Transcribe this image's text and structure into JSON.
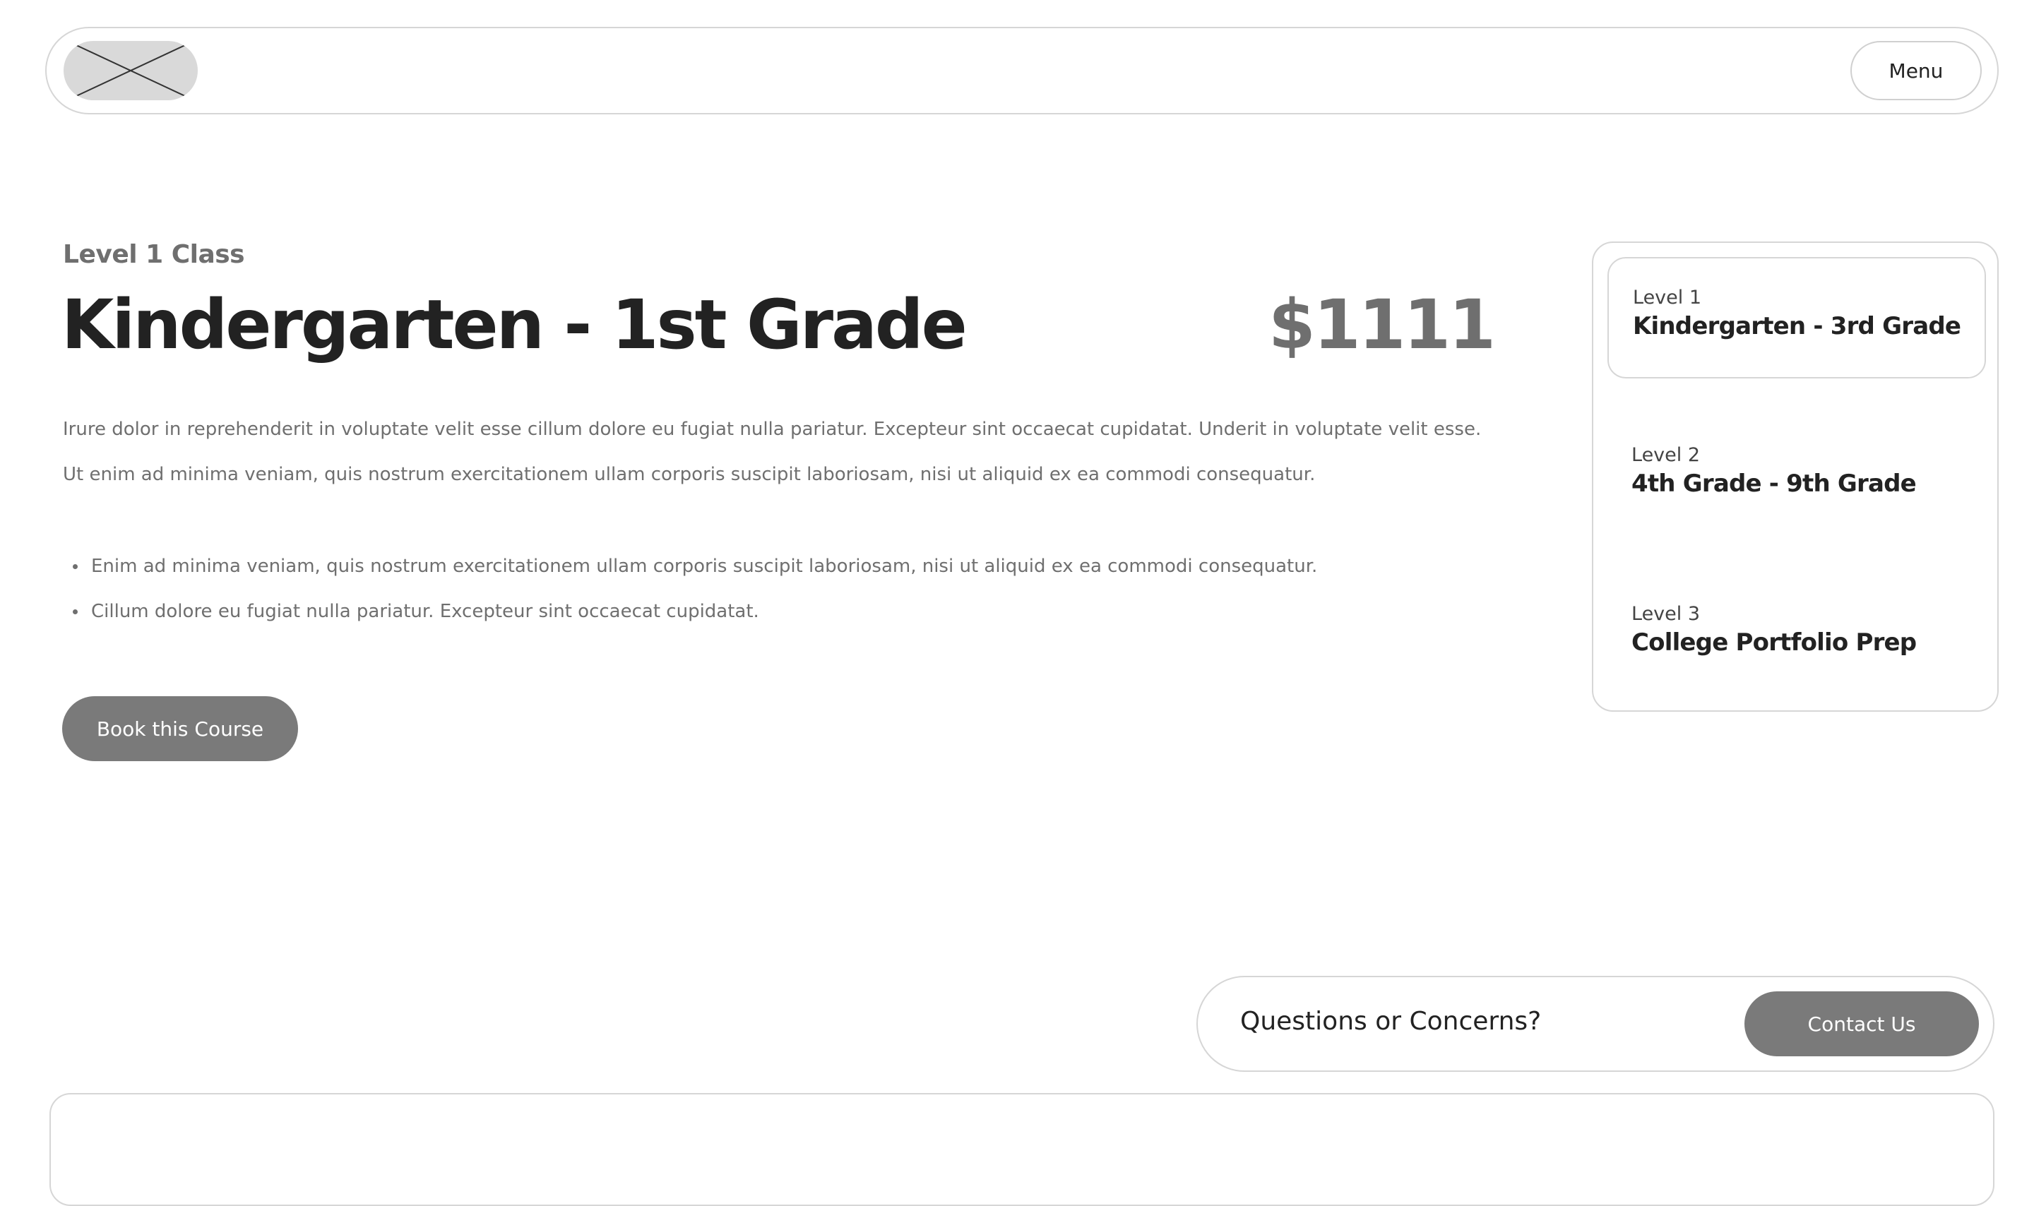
{
  "header": {
    "logo_icon": "placeholder-image-icon",
    "menu_label": "Menu"
  },
  "course": {
    "eyebrow": "Level 1 Class",
    "title": "Kindergarten - 1st Grade",
    "price": "$1111",
    "description": "Irure dolor in reprehenderit in voluptate velit esse cillum dolore eu fugiat nulla pariatur. Excepteur sint occaecat cupidatat. Underit in voluptate velit esse. Ut enim ad minima veniam, quis nostrum exercitationem ullam corporis suscipit laboriosam, nisi ut aliquid ex ea commodi consequatur.",
    "bullets": [
      "Enim ad minima veniam, quis nostrum exercitationem ullam corporis suscipit laboriosam, nisi ut aliquid ex ea commodi consequatur.",
      "Cillum dolore eu fugiat nulla pariatur. Excepteur sint occaecat cupidatat."
    ],
    "book_label": "Book this Course"
  },
  "levels": [
    {
      "level": "Level 1",
      "grade": "Kindergarten - 3rd Grade",
      "active": true
    },
    {
      "level": "Level 2",
      "grade": "4th Grade - 9th Grade",
      "active": false
    },
    {
      "level": "Level 3",
      "grade": "College Portfolio Prep",
      "active": false
    }
  ],
  "contact": {
    "prompt": "Questions or Concerns?",
    "button_label": "Contact Us"
  },
  "colors": {
    "button_fill": "#7a7a7a",
    "border": "#d6d6d6",
    "heading": "#222222",
    "muted_text": "#6f6f6f"
  }
}
